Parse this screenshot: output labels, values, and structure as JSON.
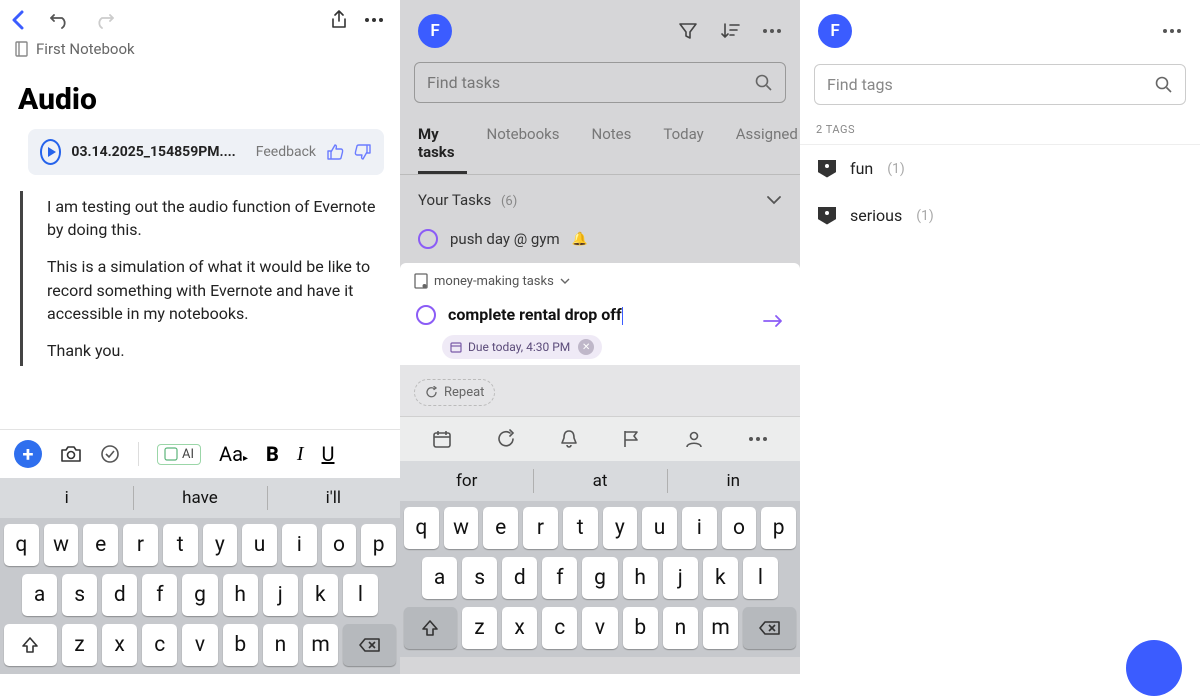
{
  "pane1": {
    "breadcrumb": "First Notebook",
    "title": "Audio",
    "audio": {
      "filename": "03.14.2025_154859PM....",
      "feedback_label": "Feedback"
    },
    "quote": {
      "p1": "I am testing out the audio function of Evernote by doing this.",
      "p2": "This is a simulation of what it would be like to record something with Evernote and have it accessible in my notebooks.",
      "p3": "Thank you."
    },
    "toolbar": {
      "ai": "AI",
      "aa": "Aa",
      "bold": "B",
      "italic": "I",
      "underline": "U"
    },
    "suggestions": [
      "i",
      "have",
      "i'll"
    ]
  },
  "pane2": {
    "avatar": "F",
    "search_placeholder": "Find tasks",
    "tabs": [
      "My tasks",
      "Notebooks",
      "Notes",
      "Today",
      "Assigned"
    ],
    "section": {
      "title": "Your Tasks",
      "count": "(6)"
    },
    "task1": "push day @ gym",
    "notebook_select": "money-making tasks",
    "editing_task": "complete rental drop off",
    "due_chip": "Due today, 4:30 PM",
    "repeat": "Repeat",
    "suggestions": [
      "for",
      "at",
      "in"
    ]
  },
  "pane3": {
    "avatar": "F",
    "search_placeholder": "Find tags",
    "header": "2 TAGS",
    "tags": [
      {
        "name": "fun",
        "count": "(1)"
      },
      {
        "name": "serious",
        "count": "(1)"
      }
    ]
  },
  "keyboard": {
    "row1": [
      "q",
      "w",
      "e",
      "r",
      "t",
      "y",
      "u",
      "i",
      "o",
      "p"
    ],
    "row2": [
      "a",
      "s",
      "d",
      "f",
      "g",
      "h",
      "j",
      "k",
      "l"
    ],
    "row3": [
      "z",
      "x",
      "c",
      "v",
      "b",
      "n",
      "m"
    ]
  }
}
